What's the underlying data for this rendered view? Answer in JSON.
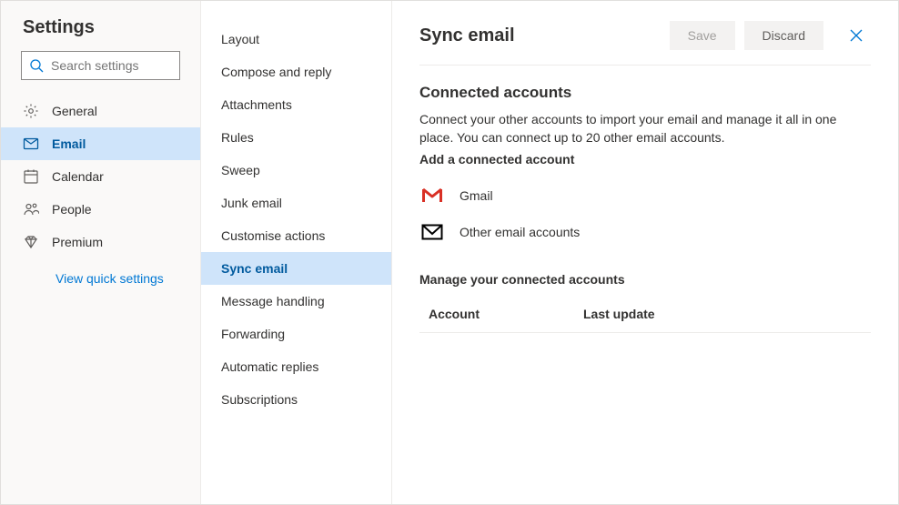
{
  "sidebar": {
    "title": "Settings",
    "search_placeholder": "Search settings",
    "items": [
      {
        "id": "general",
        "label": "General"
      },
      {
        "id": "email",
        "label": "Email"
      },
      {
        "id": "calendar",
        "label": "Calendar"
      },
      {
        "id": "people",
        "label": "People"
      },
      {
        "id": "premium",
        "label": "Premium"
      }
    ],
    "quick_settings": "View quick settings"
  },
  "submenu": {
    "items": [
      {
        "id": "layout",
        "label": "Layout"
      },
      {
        "id": "compose",
        "label": "Compose and reply"
      },
      {
        "id": "attachments",
        "label": "Attachments"
      },
      {
        "id": "rules",
        "label": "Rules"
      },
      {
        "id": "sweep",
        "label": "Sweep"
      },
      {
        "id": "junk",
        "label": "Junk email"
      },
      {
        "id": "customise",
        "label": "Customise actions"
      },
      {
        "id": "sync",
        "label": "Sync email"
      },
      {
        "id": "msghandling",
        "label": "Message handling"
      },
      {
        "id": "forwarding",
        "label": "Forwarding"
      },
      {
        "id": "autoreplies",
        "label": "Automatic replies"
      },
      {
        "id": "subs",
        "label": "Subscriptions"
      }
    ]
  },
  "content": {
    "title": "Sync email",
    "save": "Save",
    "discard": "Discard",
    "connected_title": "Connected accounts",
    "connected_desc": "Connect your other accounts to import your email and manage it all in one place. You can connect up to 20 other email accounts.",
    "add_label": "Add a connected account",
    "gmail": "Gmail",
    "other": "Other email accounts",
    "manage_title": "Manage your connected accounts",
    "th_account": "Account",
    "th_last": "Last update"
  }
}
